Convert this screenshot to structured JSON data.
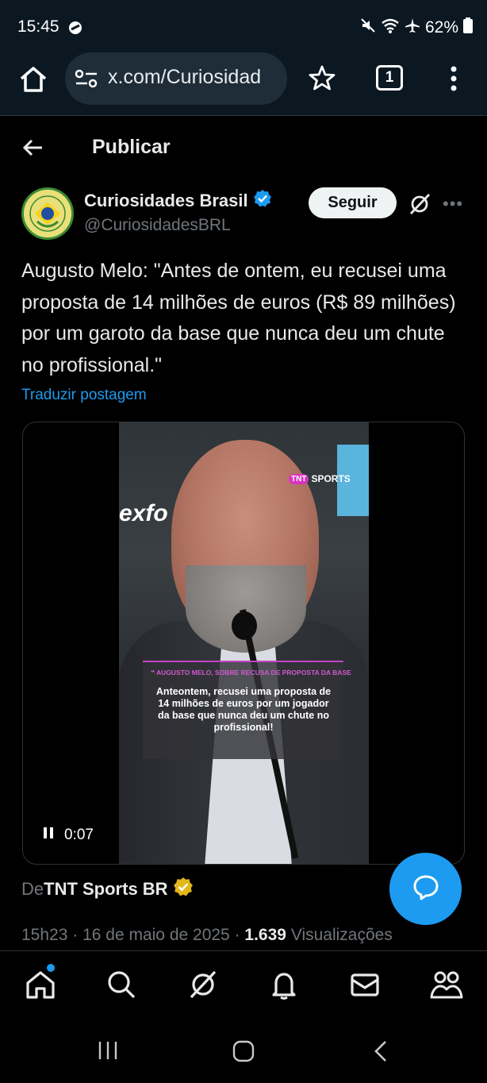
{
  "status_bar": {
    "time": "15:45",
    "battery": "62%"
  },
  "browser": {
    "url": "x.com/Curiosidad",
    "tab_count": "1"
  },
  "header": {
    "title": "Publicar"
  },
  "post": {
    "author_name": "Curiosidades Brasil",
    "author_handle": "@CuriosidadesBRL",
    "follow_label": "Seguir",
    "text": "Augusto Melo: \"Antes de ontem, eu recusei uma proposta de 14 milhões de euros (R$ 89 milhões) por um garoto da base que nunca deu um chute no profissional.\"",
    "translate_label": "Traduzir postagem",
    "video": {
      "brand_text": "exfo",
      "channel_logo": "TNT",
      "channel_text": "SPORTS",
      "caption_head": "AUGUSTO MELO, SOBRE RECUSA DE PROPOSTA DA BASE",
      "caption_body": "Anteontem, recusei uma proposta de 14 milhões de euros por um jogador da base que nunca deu um chute no profissional!",
      "elapsed": "0:07"
    },
    "source_prefix": "De",
    "source_name": "TNT Sports BR",
    "time": "15h23",
    "date": "16 de maio de 2025",
    "views_count": "1.639",
    "views_label": "Visualizações"
  },
  "icons": [
    "home-icon",
    "search-icon",
    "grok-icon",
    "bell-icon",
    "mail-icon",
    "communities-icon",
    "compose-icon",
    "verified-badge-icon",
    "pause-icon"
  ],
  "colors": {
    "accent": "#1d9bf0",
    "background": "#000000",
    "gold_badge": "#e2b719"
  }
}
